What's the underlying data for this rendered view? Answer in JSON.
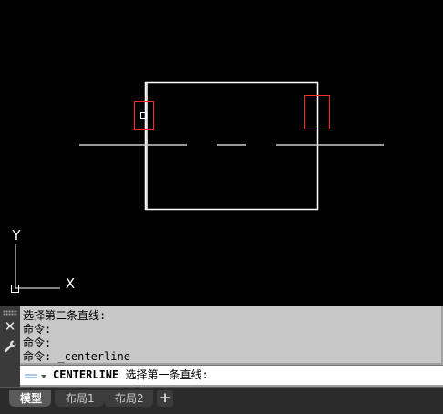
{
  "canvas": {
    "background": "#000000",
    "ucs": {
      "y_label": "Y",
      "x_label": "X"
    },
    "colors": {
      "geometry": "#ffffff",
      "centerline": "#cccccc",
      "selection_box": "#ff2a2a",
      "ucs": "#ffffff"
    }
  },
  "command_history": {
    "lines": [
      "选择第二条直线:",
      "命令:",
      "命令:",
      "命令: _centerline"
    ]
  },
  "command_line": {
    "command": "CENTERLINE",
    "prompt": " 选择第一条直线:",
    "icon": "command-prompt-icon"
  },
  "side_controls": {
    "close_label": "✕",
    "settings_icon": "wrench-icon"
  },
  "tabs": [
    {
      "label": "模型",
      "active": true
    },
    {
      "label": "布局1",
      "active": false
    },
    {
      "label": "布局2",
      "active": false
    }
  ],
  "add_tab_label": "+"
}
